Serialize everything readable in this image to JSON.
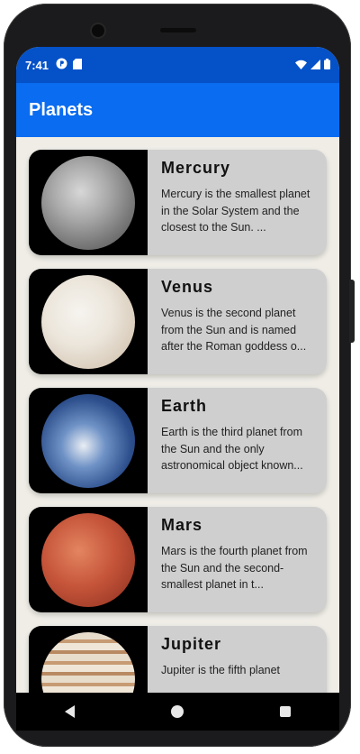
{
  "status_bar": {
    "time": "7:41",
    "icons": [
      "circle-p-icon",
      "sd-card-icon",
      "wifi-icon",
      "signal-icon",
      "battery-icon"
    ]
  },
  "app_bar": {
    "title": "Planets"
  },
  "planets": [
    {
      "name": "Mercury",
      "description": "Mercury is the smallest planet in the Solar System and the closest to the Sun. ..."
    },
    {
      "name": "Venus",
      "description": "Venus is the second planet from the Sun and is named after the Roman goddess o..."
    },
    {
      "name": "Earth",
      "description": "Earth is the third planet from the Sun and the only astronomical object known..."
    },
    {
      "name": "Mars",
      "description": "Mars is the fourth planet from the Sun and the second-smallest planet in t..."
    },
    {
      "name": "Jupiter",
      "description": "Jupiter is the fifth planet"
    }
  ],
  "colors": {
    "status_bar": "#0451c8",
    "app_bar": "#0a6cf0",
    "card": "#cfcfcf",
    "background": "#efede6"
  }
}
